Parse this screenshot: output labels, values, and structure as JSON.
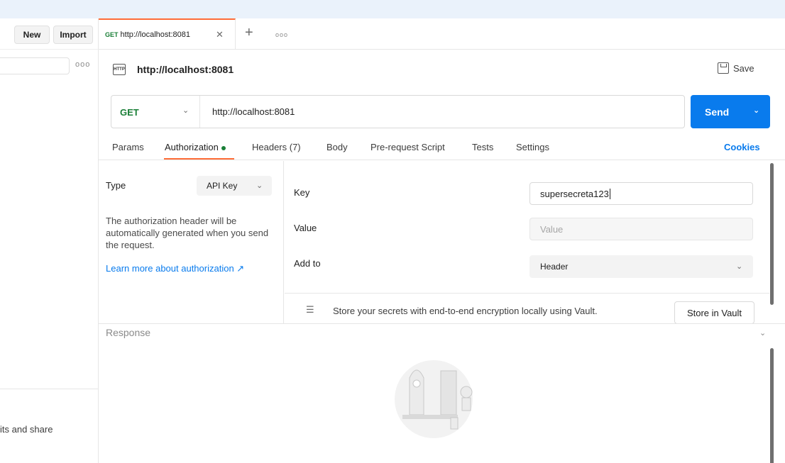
{
  "sidebar": {
    "new_label": "New",
    "import_label": "Import",
    "more_glyph": "ooo",
    "promo_text": "its and share"
  },
  "tabbar": {
    "tab": {
      "method": "GET",
      "url": "http://localhost:8081",
      "close_glyph": "✕"
    },
    "add_glyph": "+",
    "more_glyph": "ooo"
  },
  "request": {
    "title": "http://localhost:8081",
    "save_label": "Save",
    "method": "GET",
    "url": "http://localhost:8081",
    "send_label": "Send",
    "icon_text": "HTTP"
  },
  "request_tabs": [
    {
      "label": "Params"
    },
    {
      "label": "Authorization"
    },
    {
      "label": "Headers (7)"
    },
    {
      "label": "Body"
    },
    {
      "label": "Pre-request Script"
    },
    {
      "label": "Tests"
    },
    {
      "label": "Settings"
    }
  ],
  "cookies_label": "Cookies",
  "auth": {
    "type_label": "Type",
    "type_value": "API Key",
    "description": "The authorization header will be automatically generated when you send the request.",
    "learn_more": "Learn more about authorization ↗",
    "fields": {
      "key_label": "Key",
      "key_value": "supersecreta123",
      "value_label": "Value",
      "value_placeholder": "Value",
      "addto_label": "Add to",
      "addto_value": "Header"
    },
    "vault_text": "Store your secrets with end-to-end encryption locally using Vault.",
    "vault_button": "Store in Vault"
  },
  "response": {
    "title": "Response"
  },
  "colors": {
    "accent": "#ff6c37",
    "send": "#097bed",
    "method_get": "#1a7f37"
  }
}
